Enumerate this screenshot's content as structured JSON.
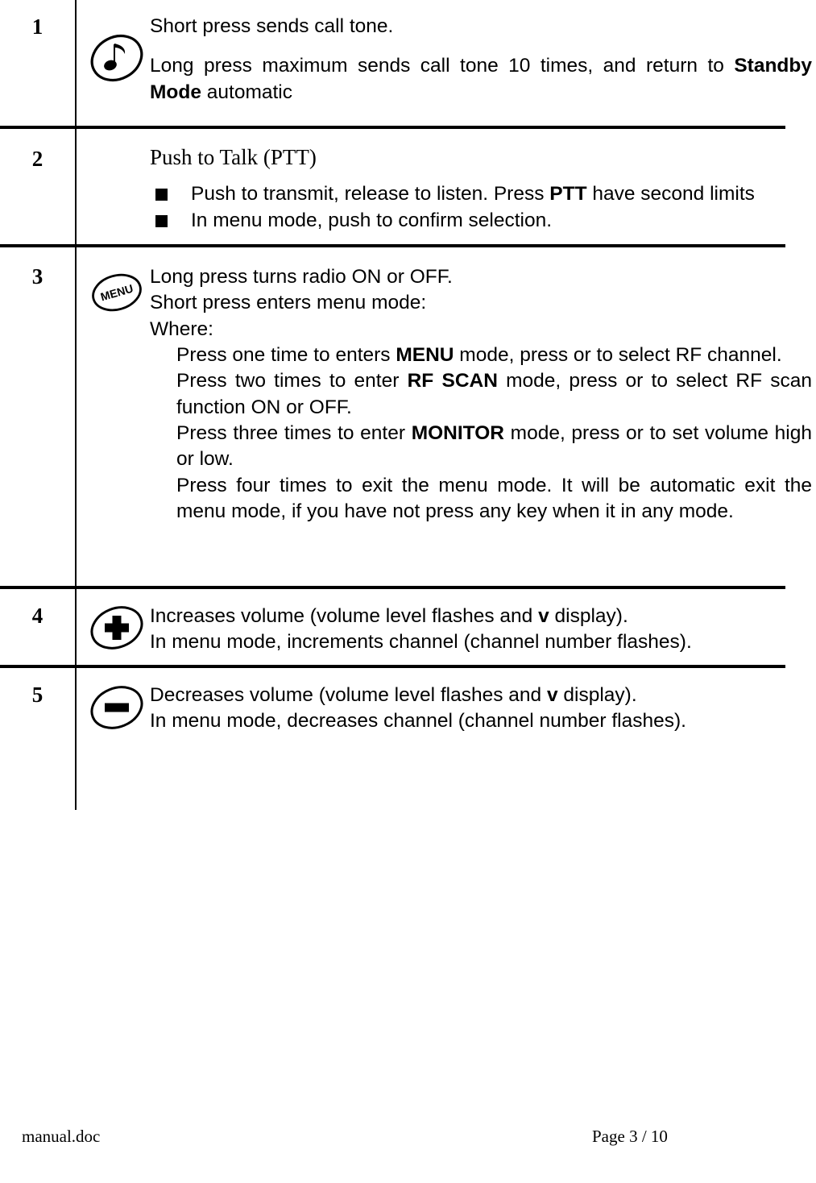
{
  "document": {
    "type": "two-way-radio-manual-control-table"
  },
  "table": {
    "rows": [
      {
        "number": "1",
        "icon": "music-note-key-icon",
        "lines": [
          {
            "text": "Short press sends call tone."
          }
        ],
        "paragraph_prefix": "Long press maximum sends call tone 10 times, and return to ",
        "paragraph_bold": "Standby Mode",
        "paragraph_suffix": " automatic"
      },
      {
        "number": "2",
        "icon": "none",
        "heading": "Push to Talk (PTT)",
        "bullets": [
          {
            "prefix": "Push to transmit, release to listen. Press ",
            "bold": "PTT",
            "suffix": " have second limits"
          },
          {
            "prefix": "In menu mode, push to confirm selection.",
            "bold": "",
            "suffix": ""
          }
        ]
      },
      {
        "number": "3",
        "icon": "menu-key-icon",
        "icon_label": "MENU",
        "lines": [
          {
            "text": "Long press turns radio ON or OFF."
          },
          {
            "text": "Short press enters menu mode:"
          },
          {
            "text": "Where:"
          }
        ],
        "steps": [
          {
            "prefix": "Press one time to enters ",
            "bold": "MENU",
            "suffix": " mode, press   or   to select RF channel."
          },
          {
            "prefix": "Press two times to enter ",
            "bold": "RF SCAN",
            "suffix": " mode, press  or  to select RF scan function ON or OFF."
          },
          {
            "prefix": " Press three times to enter ",
            "bold": "MONITOR",
            "suffix": " mode, press  or  to set volume high or low."
          },
          {
            "prefix": "Press four times to exit the menu mode. It will be automatic exit the menu mode, if you have not press any key when it in any mode.",
            "bold": "",
            "suffix": ""
          }
        ]
      },
      {
        "number": "4",
        "icon": "plus-key-icon",
        "lines_rich": [
          {
            "prefix": "Increases volume   (volume level flashes and ",
            "bold": "v",
            "suffix": " display)."
          },
          {
            "prefix": "In menu mode, increments channel (channel number flashes).",
            "bold": "",
            "suffix": ""
          }
        ]
      },
      {
        "number": "5",
        "icon": "minus-key-icon",
        "lines_rich": [
          {
            "prefix": "Decreases volume (volume level flashes and ",
            "bold": "v",
            "suffix": " display)."
          },
          {
            "prefix": "In menu mode, decreases channel (channel number flashes).",
            "bold": "",
            "suffix": ""
          }
        ]
      }
    ]
  },
  "footer": {
    "file_name": "manual.doc",
    "page_label": "Page 3 / 10"
  },
  "colors": {
    "text": "#000000",
    "background": "#ffffff",
    "rule": "#000000"
  }
}
